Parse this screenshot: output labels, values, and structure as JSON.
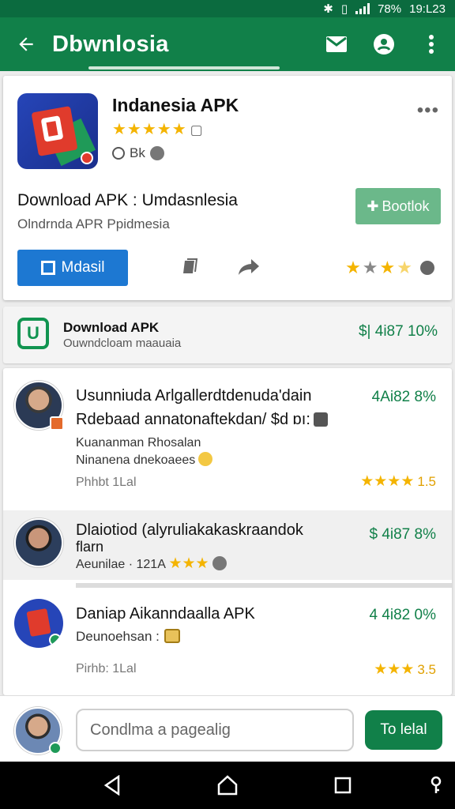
{
  "status": {
    "battery": "78%",
    "time": "19:L23"
  },
  "appbar": {
    "title": "Dbwnlosia"
  },
  "app": {
    "name": "Indanesia APK",
    "rating_stars": "★★★★★",
    "meta": "Bk",
    "download_title": "Download APK : Umdasnlesia",
    "download_sub": "Olndrnda APR Ppidmesia",
    "book_label": "Bootlok",
    "mod_label": "Mdasil",
    "rate_display": "3.5"
  },
  "download_bar": {
    "title": "Download APK",
    "subtitle": "Ouwndcloam maauaia",
    "value": "$| 4i87 10%"
  },
  "feed": [
    {
      "title": "Usunniuda Arlgallerdtdenuda'dain",
      "title2": "Rdebaad annatonaftekdan/ $d ɒı:",
      "line1": "Kuananman Rhosalan",
      "line2": "Ninanena dnekoaees",
      "foot": "Phhbt 1Lal",
      "value": "4Ai82 8%",
      "stars": "★★★★",
      "rating": "1.5"
    },
    {
      "title": "Dlaiotiod (alyruliakakaskraandok",
      "title2": "flarn",
      "line1": "Aeunilae · 121A",
      "stars": "★★★",
      "value": "$ 4i87 8%"
    },
    {
      "title": "Daniap Aikanndaalla APK",
      "line1": "Deunoehsan :",
      "foot": "Pirhb: 1Lal",
      "value": "4 4i82 0%",
      "stars": "★★★",
      "rating": "3.5"
    }
  ],
  "composer": {
    "placeholder": "Condlma a pagealig",
    "send_label": "To lelal"
  },
  "colors": {
    "brand": "#118049",
    "appbar": "#118049",
    "accent": "#1d78d2",
    "star": "#f4b400"
  }
}
